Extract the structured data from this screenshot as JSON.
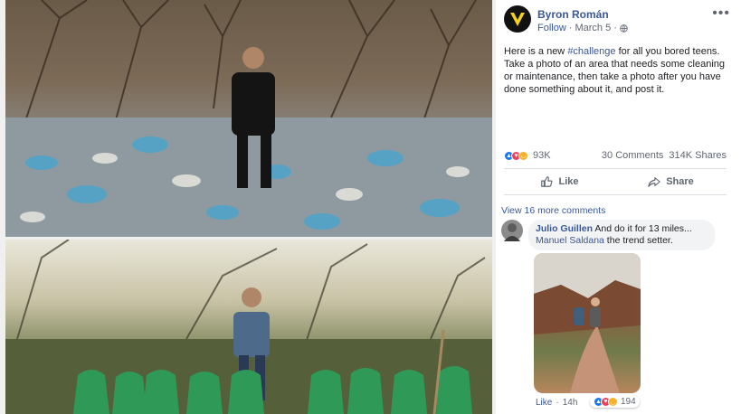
{
  "post": {
    "author": "Byron Román",
    "follow_label": "Follow",
    "separator": "·",
    "date": "March 5",
    "more_label": "•••",
    "text_before_hashtag": "Here is a new ",
    "hashtag": "#challenge",
    "text_after_hashtag": " for all you bored teens. Take a photo of an area that needs some cleaning or maintenance, then take a photo after you have done something about it, and post it.",
    "reaction_count": "93K",
    "comments_count": "30 Comments",
    "shares_count": "314K Shares",
    "like_label": "Like",
    "share_label": "Share"
  },
  "comments_section": {
    "view_more_label": "View 16 more comments",
    "comment": {
      "author": "Julio Guillen",
      "text": "And do it for 13 miles...",
      "tagged_user": "Manuel Saldana",
      "text_after_tag": " the trend setter.",
      "like_label": "Like",
      "separator": "·",
      "time": "14h",
      "reaction_count": "194"
    }
  },
  "colors": {
    "link_blue": "#385898",
    "like_blue": "#1877f2",
    "love_red": "#f33e58",
    "haha_yellow": "#f7b125",
    "muted_text": "#606770",
    "comment_bubble": "#f2f3f5"
  },
  "icons": {
    "author_logo": "v-shield-logo-icon",
    "privacy": "globe-icon",
    "like": "thumbs-up-icon",
    "share": "share-arrow-icon",
    "reactions": [
      "like-reaction-icon",
      "love-reaction-icon",
      "haha-reaction-icon"
    ]
  }
}
